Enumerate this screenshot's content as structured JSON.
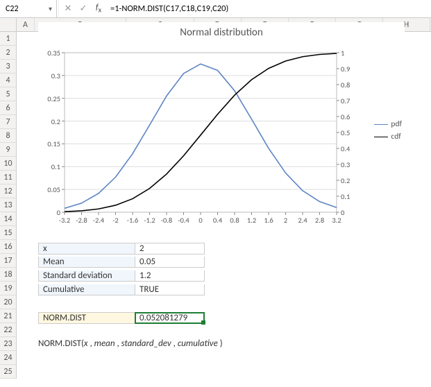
{
  "name_box": "C22",
  "formula": "=1-NORM.DIST(C17,C18,C19,C20)",
  "columns": [
    "A",
    "B",
    "C",
    "D",
    "E",
    "F",
    "G",
    "H"
  ],
  "row_count": 25,
  "chart": {
    "title": "Normal distribution"
  },
  "legend": {
    "pdf": "pdf",
    "cdf": "cdf"
  },
  "params": {
    "x_label": "x",
    "x_value": "2",
    "mean_label": "Mean",
    "mean_value": "0.05",
    "sd_label": "Standard deviation",
    "sd_value": "1.2",
    "cum_label": "Cumulative",
    "cum_value": "TRUE"
  },
  "result": {
    "label": "NORM.DIST",
    "value": "0.052081279"
  },
  "syntax": {
    "fn": "NORM.DIST(",
    "a1": "x",
    "c1": " , ",
    "a2": "mean",
    "c2": " , ",
    "a3": "standard_dev",
    "c3": " , ",
    "a4": "cumulative",
    "close": " )"
  },
  "chart_data": {
    "type": "line",
    "title": "Normal distribution",
    "xlabel": "",
    "ylabel_left": "",
    "ylabel_right": "",
    "x_ticks": [
      -3.2,
      -2.8,
      -2.4,
      -2,
      -1.6,
      -1.2,
      -0.8,
      -0.4,
      0,
      0.4,
      0.8,
      1.2,
      1.6,
      2,
      2.4,
      2.8,
      3.2
    ],
    "y_left_ticks": [
      0,
      0.05,
      0.1,
      0.15,
      0.2,
      0.25,
      0.3,
      0.35
    ],
    "y_right_ticks": [
      0,
      0.1,
      0.2,
      0.3,
      0.4,
      0.5,
      0.6,
      0.7,
      0.8,
      0.9,
      1
    ],
    "x": [
      -3.2,
      -2.8,
      -2.4,
      -2.0,
      -1.6,
      -1.2,
      -0.8,
      -0.4,
      0.0,
      0.4,
      0.8,
      1.2,
      1.6,
      2.0,
      2.4,
      2.8,
      3.2
    ],
    "series": [
      {
        "name": "pdf",
        "axis": "left",
        "values": [
          0.0085,
          0.0199,
          0.0414,
          0.077,
          0.1283,
          0.1912,
          0.2551,
          0.3044,
          0.3253,
          0.3113,
          0.2666,
          0.2043,
          0.1402,
          0.0861,
          0.0473,
          0.0233,
          0.0102
        ]
      },
      {
        "name": "cdf",
        "axis": "right",
        "values": [
          0.0034,
          0.0088,
          0.0206,
          0.0437,
          0.0845,
          0.1488,
          0.2394,
          0.3538,
          0.4834,
          0.6142,
          0.734,
          0.8311,
          0.9018,
          0.9479,
          0.975,
          0.9891,
          0.9957
        ]
      }
    ],
    "ylim_left": [
      0,
      0.35
    ],
    "ylim_right": [
      0,
      1
    ]
  }
}
